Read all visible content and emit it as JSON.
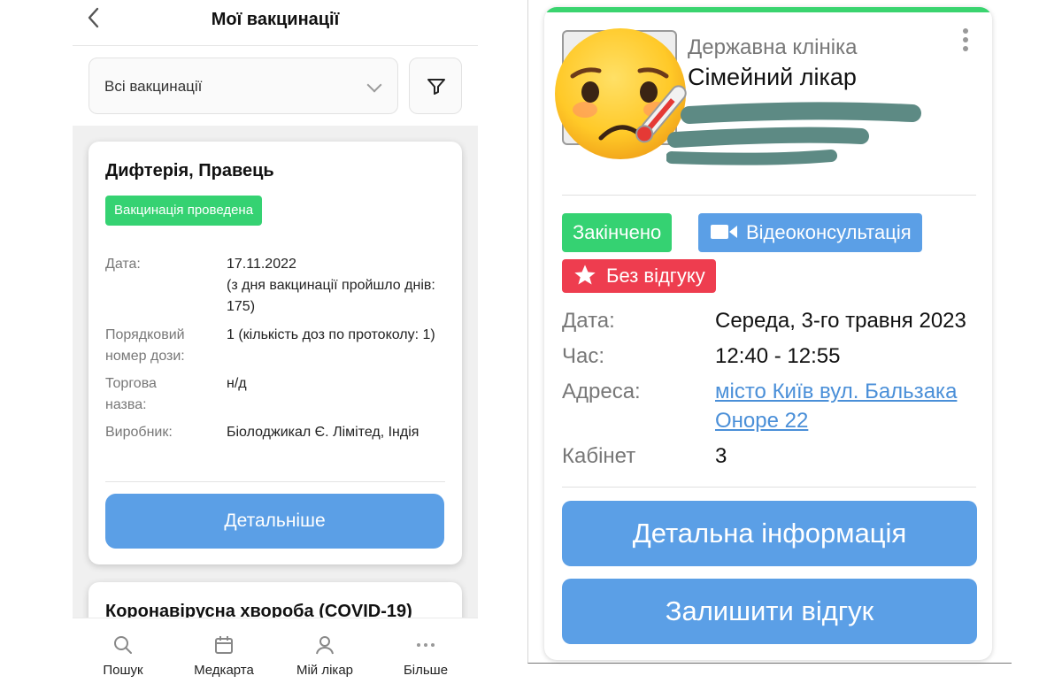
{
  "left": {
    "header": {
      "title": "Мої вакцинації"
    },
    "filter": {
      "selected": "Всі вакцинації"
    },
    "cards": [
      {
        "title": "Дифтерія, Правець",
        "status": "Вакцинація проведена",
        "fields": {
          "date_label": "Дата:",
          "date_value": "17.11.2022",
          "date_note": "(з дня вакцинації пройшло днів: 175)",
          "dose_label_1": "Порядковий",
          "dose_label_2": "номер дози:",
          "dose_value": "1 (кількість доз по протоколу: 1)",
          "trade_label_1": "Торгова",
          "trade_label_2": "назва:",
          "trade_value": "н/д",
          "maker_label": "Виробник:",
          "maker_value": "Біолоджикал Є. Лімітед, Індія"
        },
        "button": "Детальніше"
      },
      {
        "title": "Коронавірусна хвороба (COVID-19)"
      }
    ],
    "tabbar": [
      {
        "label": "Пошук",
        "icon": "search-icon"
      },
      {
        "label": "Медкарта",
        "icon": "calendar-icon"
      },
      {
        "label": "Мій лікар",
        "icon": "doctor-icon"
      },
      {
        "label": "Більше",
        "icon": "more-icon"
      }
    ]
  },
  "right": {
    "clinic": "Державна клініка",
    "doctor_type": "Сімейний лікар",
    "chips": {
      "status": "Закінчено",
      "type": "Відеоконсультація",
      "review": "Без відгуку"
    },
    "fields": {
      "date_label": "Дата:",
      "date_value": "Середа, 3-го травня 2023",
      "time_label": "Час:",
      "time_value": "12:40 - 12:55",
      "address_label": "Адреса:",
      "address_value": "місто Київ вул. Бальзака Оноре 22",
      "room_label": "Кабінет",
      "room_value": "3"
    },
    "buttons": {
      "details": "Детальна інформація",
      "review": "Залишити відгук"
    }
  },
  "colors": {
    "accent_blue": "#5b9fe6",
    "success_green": "#35d272",
    "danger_red": "#ee3d4f"
  }
}
